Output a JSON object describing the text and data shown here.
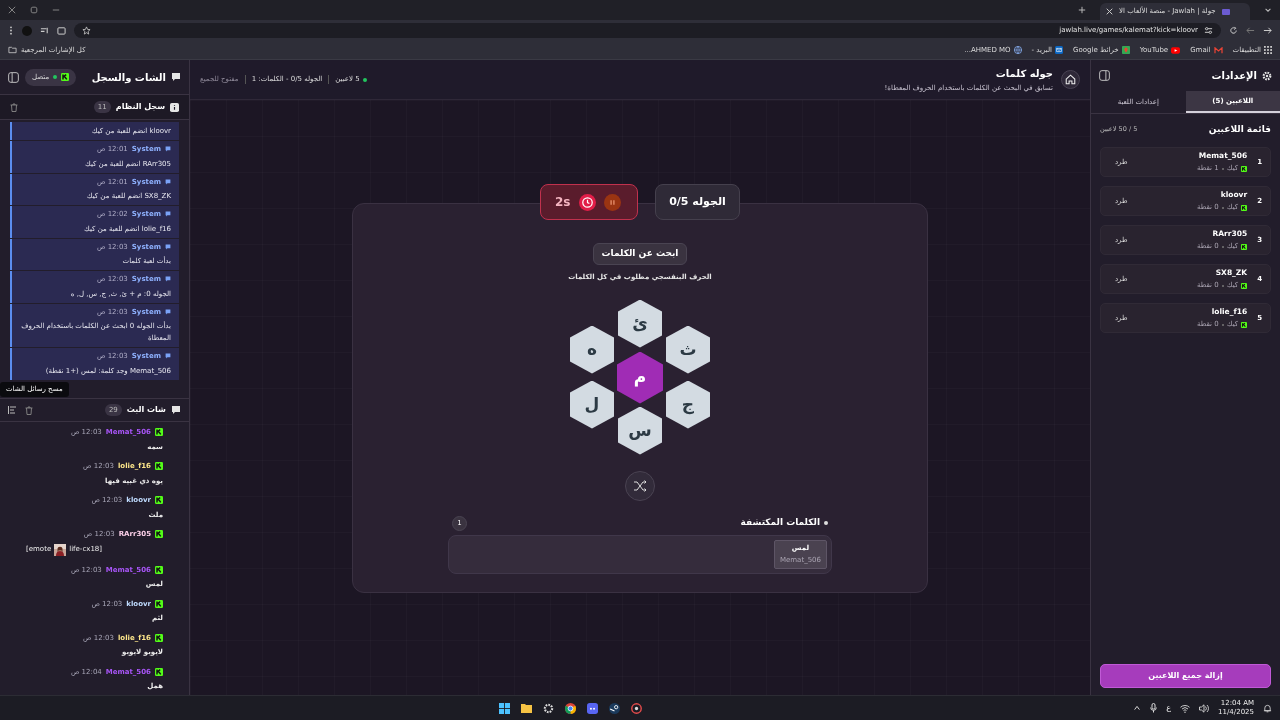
{
  "browser": {
    "tab_title": "جولة | Jawlah - منصة الألعاب الا",
    "url": "jawlah.live/games/kalemat?kick=kloovr",
    "bookmarks": [
      {
        "label": "التطبيقات",
        "kind": "apps"
      },
      {
        "label": "Gmail",
        "kind": "mail"
      },
      {
        "label": "YouTube",
        "kind": "video"
      },
      {
        "label": "خرائط Google",
        "kind": "map"
      },
      {
        "label": "البريد -",
        "kind": "mail2"
      },
      {
        "label": "AHMED MO...",
        "kind": "site"
      }
    ],
    "all_bookmarks": "كل الإشارات المرجعية"
  },
  "chat_panel": {
    "title": "الشات والسجل",
    "connection": {
      "label": "متصل",
      "connected": true
    },
    "system_log": {
      "title": "سجل النظام",
      "count": "11",
      "entries": [
        {
          "text": "kloovr انضم للعبة من كيك"
        },
        {
          "sender": "System",
          "time": "12:01 ص",
          "text": "RArr305 انضم للعبة من كيك"
        },
        {
          "sender": "System",
          "time": "12:01 ص",
          "text": "SX8_ZK انضم للعبة من كيك"
        },
        {
          "sender": "System",
          "time": "12:02 ص",
          "text": "lolie_f16 انضم للعبة من كيك"
        },
        {
          "sender": "System",
          "time": "12:03 ص",
          "text": "بدأت لعبة كلمات"
        },
        {
          "sender": "System",
          "time": "12:03 ص",
          "text": "الجوله 0: م + ئ, ث, ج, س, ل, ه"
        },
        {
          "sender": "System",
          "time": "12:03 ص",
          "text": "بدأت الجوله 0 ابحث عن الكلمات باستخدام الحروف المعطاة"
        },
        {
          "sender": "System",
          "time": "12:03 ص",
          "text": "Memat_506 وجد كلمة: لمس (+1 نقطة)"
        }
      ]
    },
    "tooltip": "مسح رسائل الشات",
    "live_chat": {
      "title": "شات البث",
      "count": "29",
      "messages": [
        {
          "user": "Memat_506",
          "color": "#a855f7",
          "time": "12:03 ص",
          "text": "سمه"
        },
        {
          "user": "lolie_f16",
          "color": "#fde68a",
          "time": "12:03 ص",
          "text": "يوه ذي غبيه فيها"
        },
        {
          "user": "kloovr",
          "color": "#bfdbfe",
          "time": "12:03 ص",
          "text": "ملث"
        },
        {
          "user": "RArr305",
          "color": "#fbcfe8",
          "time": "12:03 ص",
          "text": "[emote",
          "text_after": "life-cx18]"
        },
        {
          "user": "Memat_506",
          "color": "#a855f7",
          "time": "12:03 ص",
          "text": "لمس"
        },
        {
          "user": "kloovr",
          "color": "#bfdbfe",
          "time": "12:03 ص",
          "text": "لثم"
        },
        {
          "user": "lolie_f16",
          "color": "#fde68a",
          "time": "12:03 ص",
          "text": "لايوبو لايوبو"
        },
        {
          "user": "Memat_506",
          "color": "#a855f7",
          "time": "12:04 ص",
          "text": "همل"
        }
      ]
    }
  },
  "game": {
    "title": "جوله كلمات",
    "subtitle": "تسابق في البحث عن الكلمات باستخدام الحروف المعطاة!",
    "stats": [
      "5 لاعبين",
      "الجوله 0/5 - الكلمات: 1",
      "مفتوح للجميع"
    ],
    "timer": "2s",
    "round": "الجوله 0/5",
    "heading": "ابحث عن الكلمات",
    "hint": "الحرف البنفسجي مطلوب في كل الكلمات",
    "letters": [
      {
        "letter": "ئ",
        "required": false
      },
      {
        "letter": "ه",
        "required": false
      },
      {
        "letter": "ث",
        "required": false
      },
      {
        "letter": "م",
        "required": true
      },
      {
        "letter": "ل",
        "required": false
      },
      {
        "letter": "ج",
        "required": false
      },
      {
        "letter": "س",
        "required": false
      }
    ],
    "found": {
      "title": "الكلمات المكتشفة",
      "count": "1",
      "words": [
        {
          "word": "لمس",
          "by": "Memat_506"
        }
      ]
    }
  },
  "settings_panel": {
    "title": "الإعدادات",
    "tabs": [
      {
        "label": "اللاعبين (5)",
        "selected": true
      },
      {
        "label": "إعدادات اللعبة",
        "selected": false
      }
    ],
    "list_title": "قائمة اللاعبين",
    "list_count": "5 / 50 لاعبين",
    "players": [
      {
        "rank": "1",
        "name": "Memat_506",
        "platform": "كيك",
        "points": "1 نقطة",
        "kick": "طرد"
      },
      {
        "rank": "2",
        "name": "kloovr",
        "platform": "كيك",
        "points": "0 نقطة",
        "kick": "طرد"
      },
      {
        "rank": "3",
        "name": "RArr305",
        "platform": "كيك",
        "points": "0 نقطة",
        "kick": "طرد"
      },
      {
        "rank": "4",
        "name": "SX8_ZK",
        "platform": "كيك",
        "points": "0 نقطة",
        "kick": "طرد"
      },
      {
        "rank": "5",
        "name": "lolie_f16",
        "platform": "كيك",
        "points": "0 نقطة",
        "kick": "طرد"
      }
    ],
    "remove_all": "إزالة جميع اللاعبين"
  },
  "taskbar": {
    "language": "ع",
    "time": "12:04 AM",
    "date": "11/4/2025"
  }
}
